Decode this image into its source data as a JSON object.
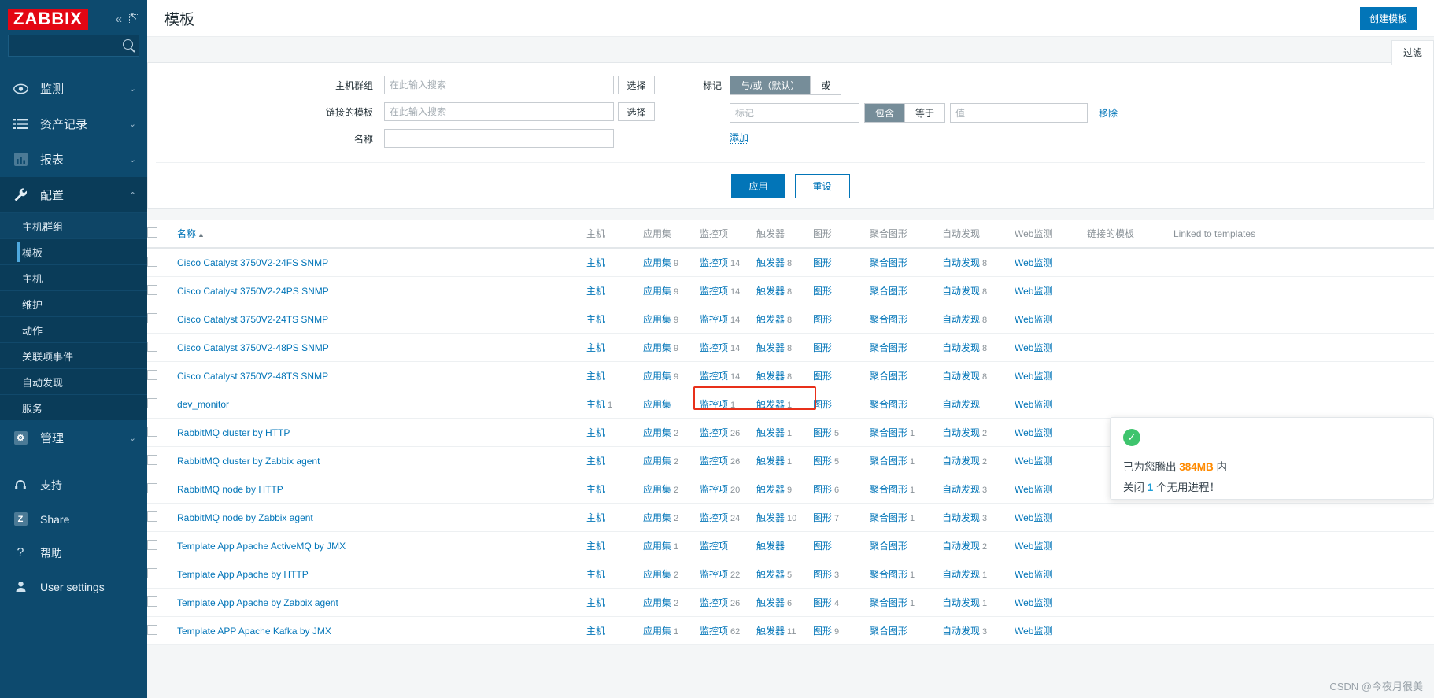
{
  "sidebar": {
    "logo": "ZABBIX",
    "collapse_icon": "«",
    "expand_icon": "expand",
    "search_placeholder": "",
    "nav": [
      {
        "label": "监测",
        "icon": "eye-icon",
        "chevron": "⌄"
      },
      {
        "label": "资产记录",
        "icon": "list-icon",
        "chevron": "⌄"
      },
      {
        "label": "报表",
        "icon": "chart-icon",
        "chevron": "⌄"
      },
      {
        "label": "配置",
        "icon": "wrench-icon",
        "chevron": "⌃"
      }
    ],
    "config_sub": [
      "主机群组",
      "模板",
      "主机",
      "维护",
      "动作",
      "关联项事件",
      "自动发现",
      "服务"
    ],
    "selected_sub": "模板",
    "admin": {
      "label": "管理",
      "icon": "gear-icon",
      "chevron": "⌄"
    },
    "foot": [
      {
        "label": "支持",
        "icon": "headset-icon"
      },
      {
        "label": "Share",
        "icon": "zabbix-share-icon"
      },
      {
        "label": "帮助",
        "icon": "question-icon"
      },
      {
        "label": "User settings",
        "icon": "user-icon"
      }
    ]
  },
  "header": {
    "title": "模板",
    "create_button": "创建模板"
  },
  "filter": {
    "tab_label": "过滤",
    "host_groups_label": "主机群组",
    "host_groups_value": "",
    "host_groups_placeholder": "在此输入搜索",
    "linked_templates_label": "链接的模板",
    "linked_templates_value": "",
    "linked_templates_placeholder": "在此输入搜索",
    "name_label": "名称",
    "name_value": "",
    "select_button": "选择",
    "tags_label": "标记",
    "tag_mode_options": [
      "与/或（默认）",
      "或"
    ],
    "tag_mode_selected": "与/或（默认）",
    "tag_name_placeholder": "标记",
    "tag_name_value": "",
    "tag_op_options": [
      "包含",
      "等于"
    ],
    "tag_op_selected": "包含",
    "tag_value_placeholder": "值",
    "tag_value_value": "",
    "remove_link": "移除",
    "add_link": "添加",
    "apply_button": "应用",
    "reset_button": "重设"
  },
  "table": {
    "columns": {
      "name": "名称",
      "sort_arrow": "▲",
      "hosts": "主机",
      "applications": "应用集",
      "items": "监控项",
      "triggers": "触发器",
      "graphs": "图形",
      "screens": "聚合图形",
      "discovery": "自动发现",
      "web": "Web监测",
      "linked_templates": "链接的模板",
      "linked_to_templates": "Linked to templates"
    },
    "rows": [
      {
        "name": "Cisco Catalyst 3750V2-24FS SNMP",
        "hosts": "",
        "applications": "9",
        "items": "14",
        "triggers": "8",
        "graphs": "",
        "screens": "",
        "discovery": "8",
        "web": "",
        "highlight": false
      },
      {
        "name": "Cisco Catalyst 3750V2-24PS SNMP",
        "hosts": "",
        "applications": "9",
        "items": "14",
        "triggers": "8",
        "graphs": "",
        "screens": "",
        "discovery": "8",
        "web": "",
        "highlight": false
      },
      {
        "name": "Cisco Catalyst 3750V2-24TS SNMP",
        "hosts": "",
        "applications": "9",
        "items": "14",
        "triggers": "8",
        "graphs": "",
        "screens": "",
        "discovery": "8",
        "web": "",
        "highlight": false
      },
      {
        "name": "Cisco Catalyst 3750V2-48PS SNMP",
        "hosts": "",
        "applications": "9",
        "items": "14",
        "triggers": "8",
        "graphs": "",
        "screens": "",
        "discovery": "8",
        "web": "",
        "highlight": false
      },
      {
        "name": "Cisco Catalyst 3750V2-48TS SNMP",
        "hosts": "",
        "applications": "9",
        "items": "14",
        "triggers": "8",
        "graphs": "",
        "screens": "",
        "discovery": "8",
        "web": "",
        "highlight": false
      },
      {
        "name": "dev_monitor",
        "hosts": "1",
        "applications": "",
        "items": "1",
        "triggers": "1",
        "graphs": "",
        "screens": "",
        "discovery": "",
        "web": "",
        "highlight": true
      },
      {
        "name": "RabbitMQ cluster by HTTP",
        "hosts": "",
        "applications": "2",
        "items": "26",
        "triggers": "1",
        "graphs": "5",
        "screens": "1",
        "discovery": "2",
        "web": "",
        "highlight": false
      },
      {
        "name": "RabbitMQ cluster by Zabbix agent",
        "hosts": "",
        "applications": "2",
        "items": "26",
        "triggers": "1",
        "graphs": "5",
        "screens": "1",
        "discovery": "2",
        "web": "",
        "highlight": false
      },
      {
        "name": "RabbitMQ node by HTTP",
        "hosts": "",
        "applications": "2",
        "items": "20",
        "triggers": "9",
        "graphs": "6",
        "screens": "1",
        "discovery": "3",
        "web": "",
        "highlight": false
      },
      {
        "name": "RabbitMQ node by Zabbix agent",
        "hosts": "",
        "applications": "2",
        "items": "24",
        "triggers": "10",
        "graphs": "7",
        "screens": "1",
        "discovery": "3",
        "web": "",
        "highlight": false
      },
      {
        "name": "Template App Apache ActiveMQ by JMX",
        "hosts": "",
        "applications": "1",
        "items": "",
        "triggers": "",
        "graphs": "",
        "screens": "",
        "discovery": "2",
        "web": "",
        "highlight": false
      },
      {
        "name": "Template App Apache by HTTP",
        "hosts": "",
        "applications": "2",
        "items": "22",
        "triggers": "5",
        "graphs": "3",
        "screens": "1",
        "discovery": "1",
        "web": "",
        "highlight": false
      },
      {
        "name": "Template App Apache by Zabbix agent",
        "hosts": "",
        "applications": "2",
        "items": "26",
        "triggers": "6",
        "graphs": "4",
        "screens": "1",
        "discovery": "1",
        "web": "",
        "highlight": false
      },
      {
        "name": "Template APP Apache Kafka by JMX",
        "hosts": "",
        "applications": "1",
        "items": "62",
        "triggers": "11",
        "graphs": "9",
        "screens": "",
        "discovery": "3",
        "web": "",
        "highlight": false
      }
    ]
  },
  "toast": {
    "icon": "check-circle-icon",
    "line1_pre": "已为您腾出 ",
    "line1_em": "384MB",
    "line1_post": " 内",
    "line2_pre": "关闭 ",
    "line2_em": "1",
    "line2_post": " 个无用进程！"
  },
  "watermark": "CSDN @今夜月很美"
}
